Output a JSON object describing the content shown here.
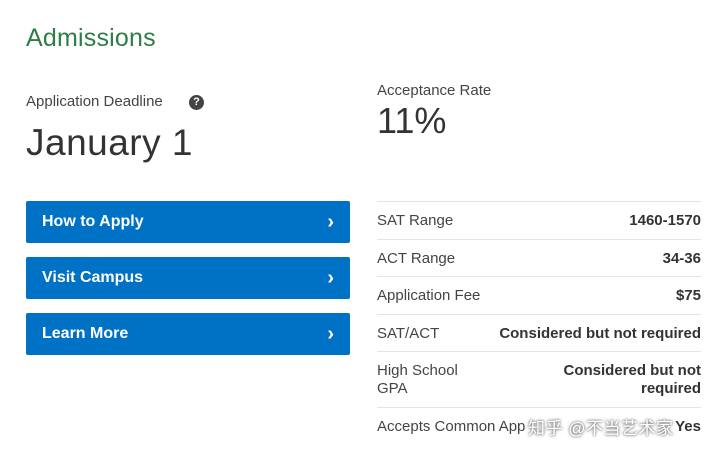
{
  "section": {
    "title": "Admissions"
  },
  "deadline": {
    "label": "Application Deadline",
    "help_icon": "?",
    "value": "January 1"
  },
  "acceptance": {
    "label": "Acceptance Rate",
    "value": "11%"
  },
  "buttons": [
    {
      "label": "How to Apply",
      "icon": "chevron-right-icon"
    },
    {
      "label": "Visit Campus",
      "icon": "chevron-right-icon"
    },
    {
      "label": "Learn More",
      "icon": "chevron-right-icon"
    }
  ],
  "stats": [
    {
      "label": "SAT Range",
      "value": "1460-1570"
    },
    {
      "label": "ACT Range",
      "value": "34-36"
    },
    {
      "label": "Application Fee",
      "value": "$75"
    },
    {
      "label": "SAT/ACT",
      "value": "Considered but not required"
    },
    {
      "label": "High School GPA",
      "value": "Considered but not required"
    },
    {
      "label": "Accepts Common App",
      "value": "Yes"
    }
  ],
  "watermark": "知乎 @不当艺术家",
  "colors": {
    "heading": "#2e7d46",
    "button": "#0072c6"
  }
}
